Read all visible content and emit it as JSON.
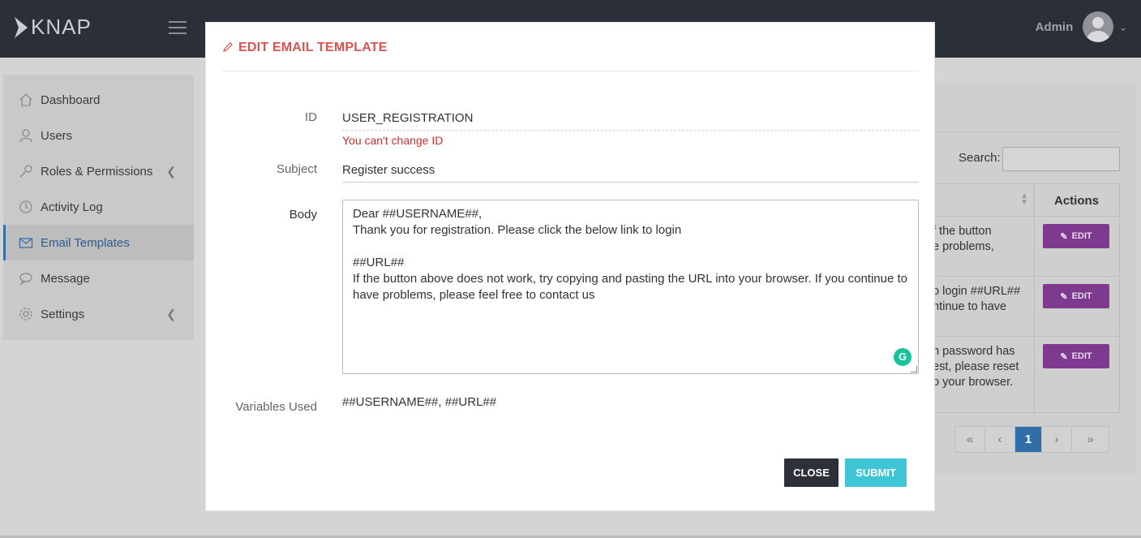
{
  "header": {
    "logo_text": "KNAP",
    "user_name": "Admin"
  },
  "sidebar": {
    "items": [
      {
        "label": "Dashboard",
        "icon": "home-icon"
      },
      {
        "label": "Users",
        "icon": "user-icon"
      },
      {
        "label": "Roles & Permissions",
        "icon": "key-icon"
      },
      {
        "label": "Activity Log",
        "icon": "clock-icon"
      },
      {
        "label": "Email Templates",
        "icon": "envelope-icon"
      },
      {
        "label": "Message",
        "icon": "chat-icon"
      },
      {
        "label": "Settings",
        "icon": "gear-icon"
      }
    ]
  },
  "background_panel": {
    "search_label": "Search:",
    "table_header_actions": "Actions",
    "rows": [
      {
        "lines": [
          "f the button",
          "e problems,"
        ],
        "action": "EDIT"
      },
      {
        "lines": [
          "o login ##URL##",
          "ntinue to have"
        ],
        "action": "EDIT"
      },
      {
        "lines": [
          "n password has",
          "est, please reset",
          "o your browser."
        ],
        "action": "EDIT"
      }
    ],
    "pagination": [
      "«",
      "‹",
      "1",
      "›",
      "»"
    ]
  },
  "modal": {
    "title": "EDIT EMAIL TEMPLATE",
    "id_label": "ID",
    "id_value": "USER_REGISTRATION",
    "id_note": "You can't change ID",
    "subject_label": "Subject",
    "subject_value": "Register success",
    "body_label": "Body",
    "body_lines": [
      "Dear ##USERNAME##,",
      "Thank you for registration. Please click the below link to login",
      "",
      "##URL##",
      "If the button above does not work, try copying and pasting the URL into your browser. If you continue to",
      "have problems, please feel free to contact us"
    ],
    "variables_label": "Variables Used",
    "variables_value": "##USERNAME##, ##URL##",
    "close_label": "CLOSE",
    "submit_label": "SUBMIT"
  },
  "colors": {
    "topbar": "#2b2f37",
    "title_red": "#d9534f",
    "edit_purple": "#7e3a8e",
    "submit_cyan": "#3ec6d6",
    "page_active_blue": "#2f6ea6"
  }
}
